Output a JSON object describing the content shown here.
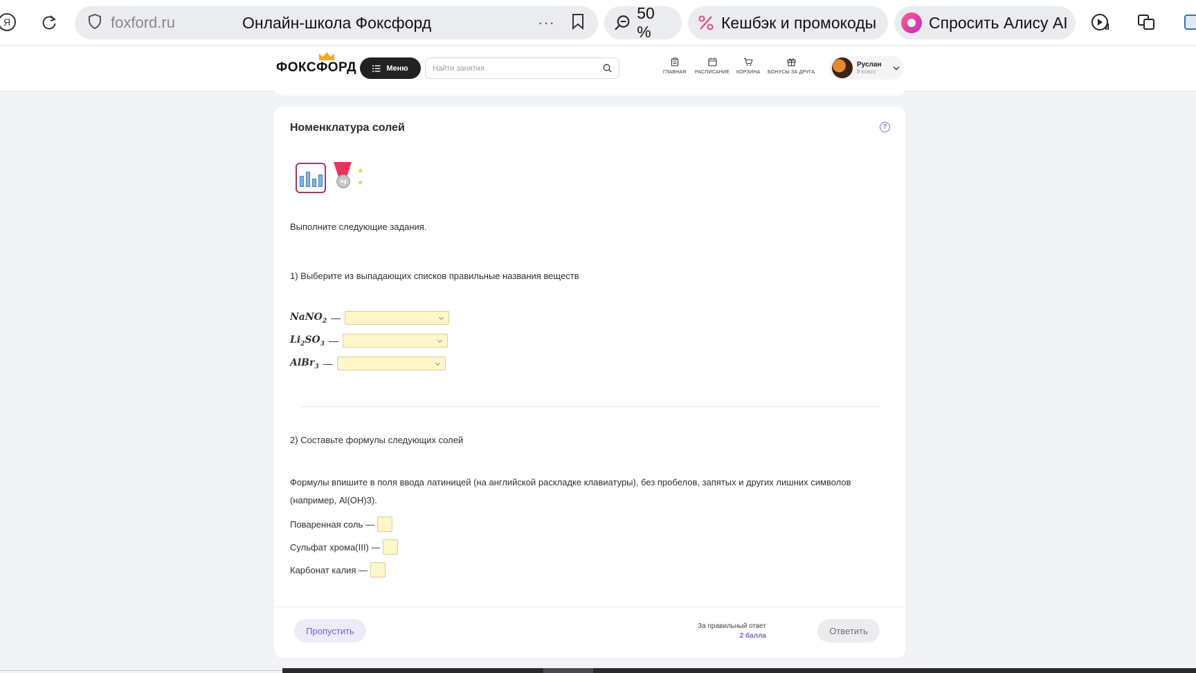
{
  "browser": {
    "domain": "foxford.ru",
    "page_title": "Онлайн-школа Фоксфорд",
    "more": "···",
    "zoom": "50 %",
    "cashback_label": "Кешбэк и промокоды",
    "alice_label": "Спросить Алису AI",
    "yandex_glyph": "Я"
  },
  "header": {
    "logo_text": "ФОКСФОРД",
    "menu_label": "Меню",
    "search_placeholder": "Найти занятия",
    "nav": [
      {
        "label": "ГЛАВНАЯ",
        "icon": "clipboard-icon"
      },
      {
        "label": "РАСПИСАНИЕ",
        "icon": "calendar-icon"
      },
      {
        "label": "КОРЗИНА",
        "icon": "cart-icon"
      },
      {
        "label": "БОНУСЫ ЗА ДРУГА",
        "icon": "gift-icon"
      }
    ],
    "user": {
      "name": "Руслан",
      "grade": "8 класс"
    }
  },
  "task": {
    "title": "Номенклатура солей",
    "medal_label": "Ag",
    "intro": "Выполните следующие задания.",
    "q1": "1) Выберите из выпадающих списков правильные названия веществ",
    "formulas": [
      {
        "base": "NaNO",
        "sub": "2",
        "base2": "",
        "sub2": ""
      },
      {
        "base": "Li",
        "sub": "2",
        "base2": "SO",
        "sub2": "3"
      },
      {
        "base": "AlBr",
        "sub": "3",
        "base2": "",
        "sub2": ""
      }
    ],
    "dash": "—",
    "q2": "2) Составьте формулы следующих солей",
    "instructions": "Формулы впишите в поля ввода латиницей (на английской раскладке клавиатуры), без пробелов, запятых и других лишних символов (например, Al(OH)3).",
    "salts": [
      "Поваренная соль —",
      "Сульфат хрома(III) —",
      "Карбонат калия —"
    ]
  },
  "footer": {
    "skip_label": "Пропустить",
    "reward_text": "За правильный ответ",
    "reward_points": "2 балла",
    "answer_label": "Ответить"
  },
  "colors": {
    "accent": "#7a5bc9",
    "input_bg": "#fff6c9",
    "dark": "#222222"
  }
}
